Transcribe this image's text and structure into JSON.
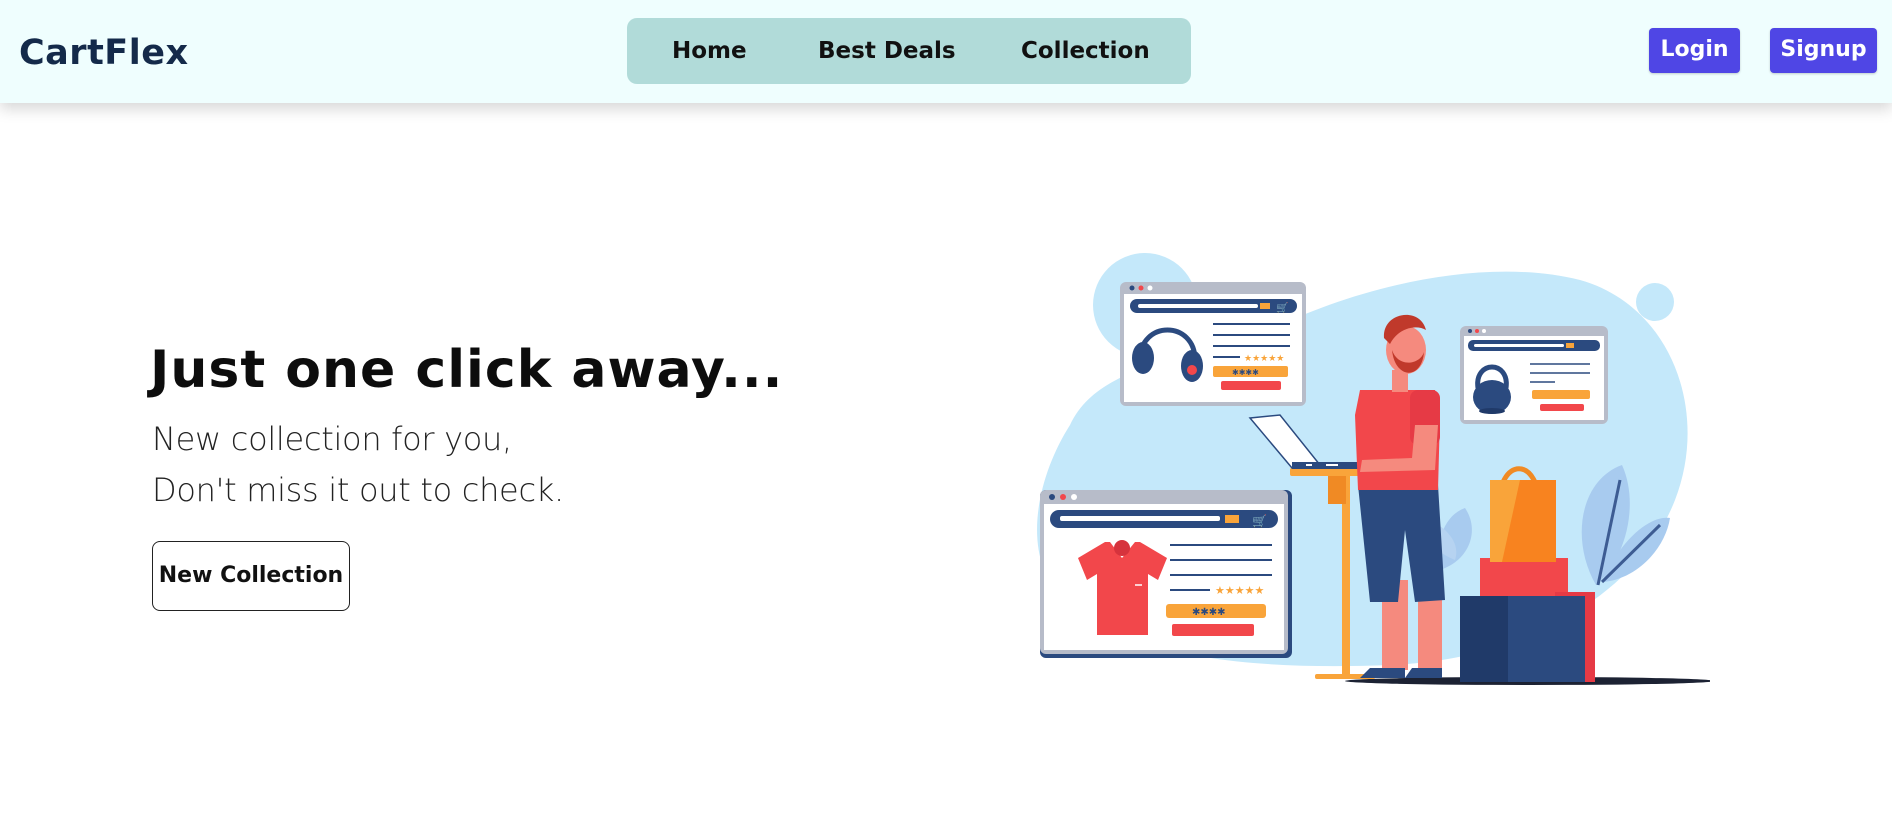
{
  "brand": {
    "name": "CartFlex"
  },
  "nav": {
    "items": [
      {
        "label": "Home"
      },
      {
        "label": "Best Deals"
      },
      {
        "label": "Collection"
      }
    ]
  },
  "auth": {
    "login_label": "Login",
    "signup_label": "Signup"
  },
  "hero": {
    "title": "Just one click away...",
    "subtitle_line1": "New collection for you,",
    "subtitle_line2": "Don't miss it out to check.",
    "cta_label": "New Collection"
  },
  "illustration": {
    "name": "online-shopping-illustration",
    "rating_stars": "★★★★★",
    "price_tag": "✱✱✱✱"
  },
  "colors": {
    "header_bg": "#effefe",
    "nav_bg": "#b1dbd9",
    "auth_button": "#4f46e5",
    "brand_text": "#142a4a",
    "blob": "#c4e8fa",
    "accent_red": "#f2474b",
    "accent_orange": "#f9a43a",
    "navy": "#2b4a7f"
  }
}
